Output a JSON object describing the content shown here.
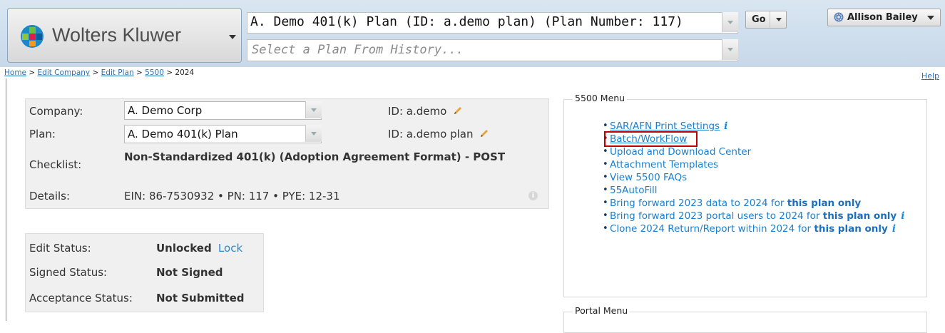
{
  "header": {
    "brand": "Wolters Kluwer",
    "plan_selected": "A. Demo 401(k) Plan (ID: a.demo plan) (Plan Number: 117)",
    "history_placeholder": "Select a Plan From History...",
    "go_label": "Go",
    "user_name": "Allison Bailey"
  },
  "breadcrumb": {
    "items": [
      "Home",
      "Edit Company",
      "Edit Plan",
      "5500"
    ],
    "current": "2024",
    "separator": ">"
  },
  "help_link": "Help",
  "info": {
    "company_label": "Company:",
    "company_value": "A. Demo Corp",
    "company_id": "ID: a.demo",
    "plan_label": "Plan:",
    "plan_value": "A. Demo 401(k) Plan",
    "plan_id": "ID: a.demo plan",
    "checklist_label": "Checklist:",
    "checklist_value": "Non-Standardized 401(k) (Adoption Agreement Format) - POST",
    "details_label": "Details:",
    "details_value": "EIN: 86-7530932 • PN: 117 • PYE: 12-31"
  },
  "status": {
    "edit_label": "Edit Status:",
    "edit_value": "Unlocked",
    "lock_link": "Lock",
    "signed_label": "Signed Status:",
    "signed_value": "Not Signed",
    "acceptance_label": "Acceptance Status:",
    "acceptance_value": "Not Submitted"
  },
  "menu_5500": {
    "legend": "5500 Menu",
    "sar_afn": "SAR/AFN Print Settings",
    "batch": "Batch/WorkFlow",
    "upload": "Upload and Download Center",
    "attachments": "Attachment Templates",
    "faqs": "View 5500 FAQs",
    "autofill": "55AutoFill",
    "bring_data": "Bring forward 2023 data to 2024 for ",
    "bring_data_bold": "this plan only",
    "bring_users": "Bring forward 2023 portal users to 2024 for ",
    "bring_users_bold": "this plan only",
    "clone": "Clone 2024 Return/Report within 2024 for ",
    "clone_bold": "this plan only"
  },
  "portal_menu": {
    "legend": "Portal Menu"
  },
  "colors": {
    "link": "#1a7fd0",
    "highlight": "#c00000",
    "header_bg": "#c7d8e9"
  }
}
